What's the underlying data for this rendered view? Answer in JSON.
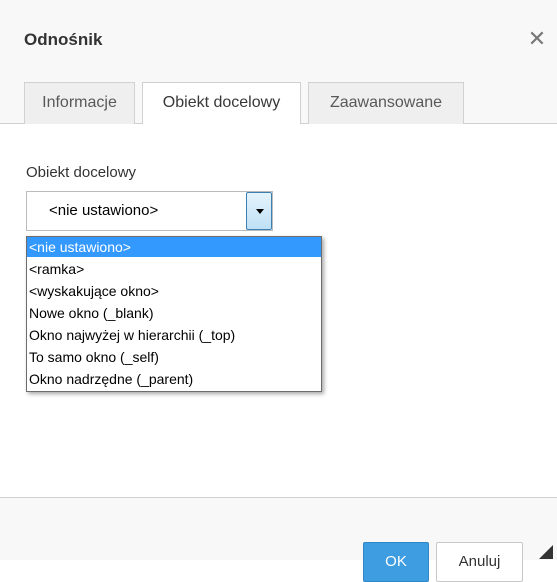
{
  "dialog": {
    "title": "Odnośnik",
    "close_glyph": "✕"
  },
  "tabs": [
    {
      "label": "Informacje",
      "active": false
    },
    {
      "label": "Obiekt docelowy",
      "active": true
    },
    {
      "label": "Zaawansowane",
      "active": false
    }
  ],
  "target": {
    "label": "Obiekt docelowy",
    "selected_value": "<nie ustawiono>",
    "options": [
      "<nie ustawiono>",
      "<ramka>",
      "<wyskakujące okno>",
      "Nowe okno (_blank)",
      "Okno najwyżej w hierarchii (_top)",
      "To samo okno (_self)",
      "Okno nadrzędne (_parent)"
    ],
    "highlighted_index": 0
  },
  "footer": {
    "ok_label": "OK",
    "cancel_label": "Anuluj"
  },
  "colors": {
    "accent": "#3e9ce0",
    "selection": "#3399ff",
    "panel_bg": "#f8f8f8",
    "border": "#d1d1d1"
  },
  "icons": {
    "close": "close-icon",
    "dropdown": "chevron-down-icon",
    "resize": "resize-grip-icon"
  }
}
